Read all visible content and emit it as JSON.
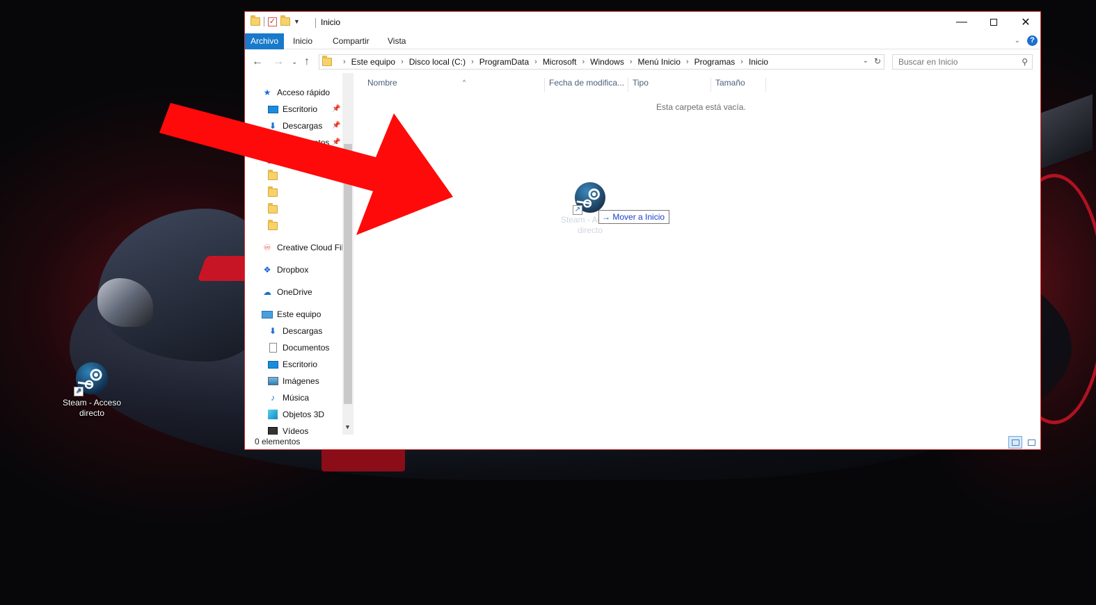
{
  "desktop": {
    "icon_label": "Steam - Acceso directo"
  },
  "window": {
    "title": "Inicio",
    "controls": {
      "minimize": "—",
      "maximize": "",
      "close": "✕"
    }
  },
  "ribbon": {
    "tabs": [
      "Archivo",
      "Inicio",
      "Compartir",
      "Vista"
    ],
    "help": "?"
  },
  "address": {
    "crumbs": [
      "Este equipo",
      "Disco local (C:)",
      "ProgramData",
      "Microsoft",
      "Windows",
      "Menú Inicio",
      "Programas",
      "Inicio"
    ],
    "search_placeholder": "Buscar en Inicio"
  },
  "nav_pane": {
    "quick_access": "Acceso rápido",
    "pinned": [
      "Escritorio",
      "Descargas",
      "Documentos"
    ],
    "cloud": [
      "Creative Cloud Files",
      "Dropbox",
      "OneDrive"
    ],
    "this_pc": "Este equipo",
    "pc_items": [
      "Descargas",
      "Documentos",
      "Escritorio",
      "Imágenes",
      "Música",
      "Objetos 3D",
      "Vídeos"
    ]
  },
  "content": {
    "columns": [
      "Nombre",
      "Fecha de modifica...",
      "Tipo",
      "Tamaño"
    ],
    "empty_message": "Esta carpeta está vacía.",
    "drag_label": "Steam - Acceso directo",
    "drag_tooltip": "Mover a Inicio"
  },
  "statusbar": {
    "items": "0 elementos"
  },
  "colors": {
    "accent": "#1979ca",
    "window_border": "#e03030",
    "arrow": "#ff0a0a"
  }
}
